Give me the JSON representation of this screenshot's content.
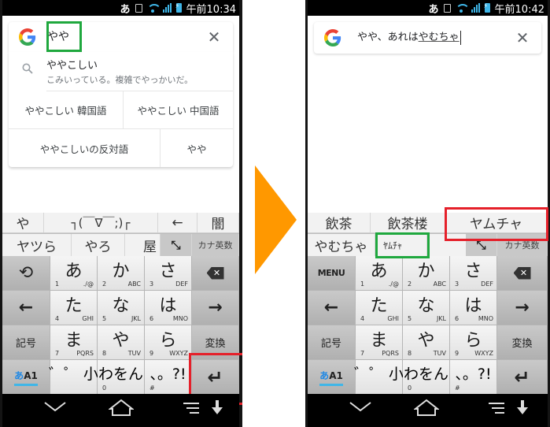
{
  "colors": {
    "highlight_green": "#1fa83e",
    "highlight_red": "#e5202a",
    "arrow_orange": "#ff9800",
    "accent_blue": "#3fb6e8"
  },
  "left": {
    "status": {
      "ime": "あ",
      "time": "午前10:34"
    },
    "search": {
      "query": "やや",
      "clear_icon": "close-icon"
    },
    "suggestion": {
      "main": "ややこしい",
      "sub": "こみいっている。複雑でやっかいだ。"
    },
    "chips_row1": [
      "ややこしい 韓国語",
      "ややこしい 中国語"
    ],
    "chips_row2": [
      "ややこしいの反対語",
      "やや"
    ],
    "candidates_row1": [
      "や",
      "┐(￣∇￣;)┌",
      "←",
      "闇"
    ],
    "candidates_row2": [
      "ヤツら",
      "やろ",
      "屋"
    ],
    "tool_resize": "⤡",
    "tool_kana_eisu": "カナ英数",
    "func_top_left": "undo",
    "func_top_left_glyph": "⟲"
  },
  "right": {
    "status": {
      "ime": "あ",
      "time": "午前10:42"
    },
    "search": {
      "query_plain": "やや、あれは",
      "query_composing": "やむちゃ",
      "clear_icon": "close-icon"
    },
    "candidates_row1": [
      "飲茶",
      "飲茶楼",
      "ヤムチャ"
    ],
    "candidates_row2": [
      "やむちゃ",
      "ﾔﾑﾁｬ"
    ],
    "tool_resize": "⤡",
    "tool_kana_eisu": "カナ英数",
    "func_top_left": "MENU"
  },
  "keyboard": {
    "rows": [
      [
        {
          "kana": "あ",
          "num": "1",
          "alpha": "./@"
        },
        {
          "kana": "か",
          "num": "2",
          "alpha": "ABC"
        },
        {
          "kana": "さ",
          "num": "3",
          "alpha": "DEF"
        }
      ],
      [
        {
          "kana": "た",
          "num": "4",
          "alpha": "GHI"
        },
        {
          "kana": "な",
          "num": "5",
          "alpha": "JKL"
        },
        {
          "kana": "は",
          "num": "6",
          "alpha": "MNO"
        }
      ],
      [
        {
          "kana": "ま",
          "num": "7",
          "alpha": "PQRS"
        },
        {
          "kana": "や",
          "num": "8",
          "alpha": "TUV"
        },
        {
          "kana": "ら",
          "num": "9",
          "alpha": "WXYZ"
        }
      ],
      [
        {
          "kana": "゛゜ 小",
          "num": "",
          "alpha": ""
        },
        {
          "kana": "わをん",
          "num": "0",
          "alpha": ""
        },
        {
          "kana": "、。?!",
          "num": "#",
          "alpha": ""
        }
      ]
    ],
    "left_col": [
      "",
      "←",
      "記号",
      "あA1"
    ],
    "right_col": [
      "⌫",
      "→",
      "変換",
      "↵"
    ],
    "mode_a": "あ",
    "mode_rest": "A1"
  }
}
